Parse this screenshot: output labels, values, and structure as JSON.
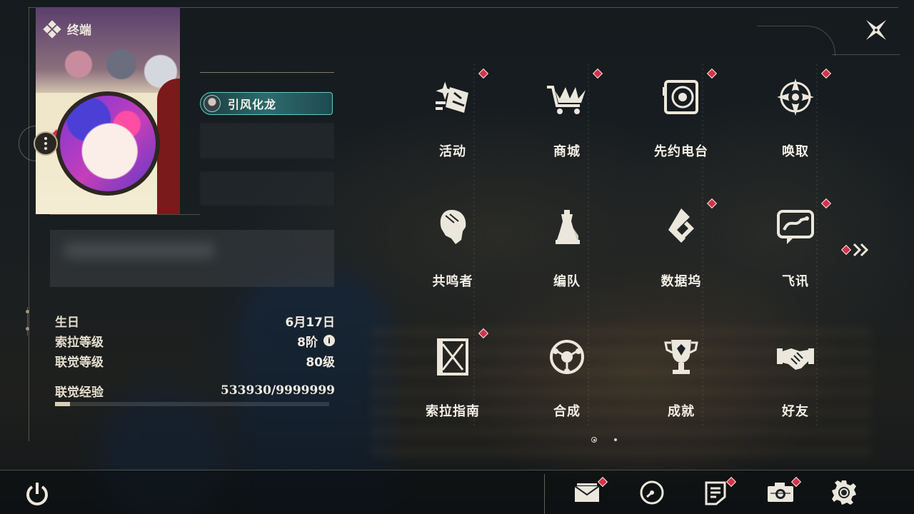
{
  "header": {
    "title": "终端"
  },
  "profile": {
    "player_name": "引风化龙",
    "stats": [
      {
        "label": "生日",
        "value": "6月17日"
      },
      {
        "label": "索拉等级",
        "value": "8阶"
      },
      {
        "label": "联觉等级",
        "value": "80级"
      }
    ],
    "exp": {
      "label": "联觉经验",
      "value": "533930/9999999",
      "progress": 0.0534
    }
  },
  "menu": {
    "items": [
      {
        "label": "活动",
        "icon": "sparkle-event-icon",
        "badge": true
      },
      {
        "label": "商城",
        "icon": "shop-crown-cart-icon",
        "badge": true
      },
      {
        "label": "先约电台",
        "icon": "radio-speaker-icon",
        "badge": true
      },
      {
        "label": "唤取",
        "icon": "summon-compass-icon",
        "badge": true
      },
      {
        "label": "共鸣者",
        "icon": "resonator-head-icon",
        "badge": false
      },
      {
        "label": "编队",
        "icon": "team-chess-icon",
        "badge": false
      },
      {
        "label": "数据坞",
        "icon": "data-dock-icon",
        "badge": true
      },
      {
        "label": "飞讯",
        "icon": "message-chat-icon",
        "badge": true
      },
      {
        "label": "索拉指南",
        "icon": "guide-book-icon",
        "badge": true
      },
      {
        "label": "合成",
        "icon": "synthesis-ring-icon",
        "badge": false
      },
      {
        "label": "成就",
        "icon": "trophy-icon",
        "badge": false
      },
      {
        "label": "好友",
        "icon": "handshake-icon",
        "badge": false
      }
    ],
    "page_current": 1,
    "page_total": 2
  },
  "bottom_bar": {
    "icons": [
      "power-icon",
      "mail-icon",
      "clock-icon",
      "notice-icon",
      "camera-icon",
      "settings-gear-icon"
    ]
  },
  "colors": {
    "badge": "#d2334a",
    "text": "#ece7dc",
    "nameplate": "#2d6b6e"
  }
}
